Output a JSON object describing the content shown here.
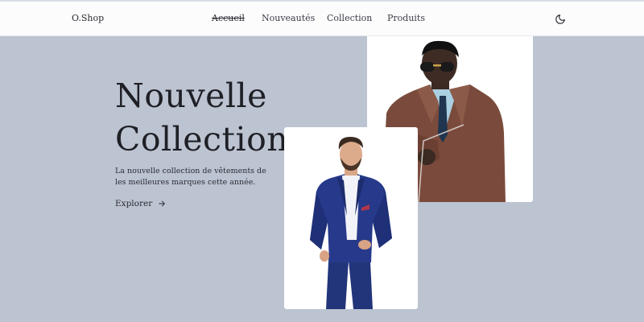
{
  "header": {
    "logo": "O.Shop",
    "nav": [
      {
        "label": "Accueil",
        "active": true
      },
      {
        "label": "Nouveautés",
        "active": false
      },
      {
        "label": "Collection",
        "active": false
      },
      {
        "label": "Produits",
        "active": false
      }
    ],
    "theme_icon": "moon-icon"
  },
  "hero": {
    "title_line1": "Nouvelle",
    "title_line2": "Collection",
    "description": "La nouvelle collection de vêtements de les meilleures marques cette année.",
    "cta_label": "Explorer",
    "cta_icon": "arrow-right-icon"
  },
  "images": {
    "top": "man-leather-jacket-photo",
    "bottom": "man-blue-suit-photo"
  },
  "colors": {
    "background": "#bcc3d1",
    "header": "#fcfcfd",
    "text": "#1f2026"
  }
}
